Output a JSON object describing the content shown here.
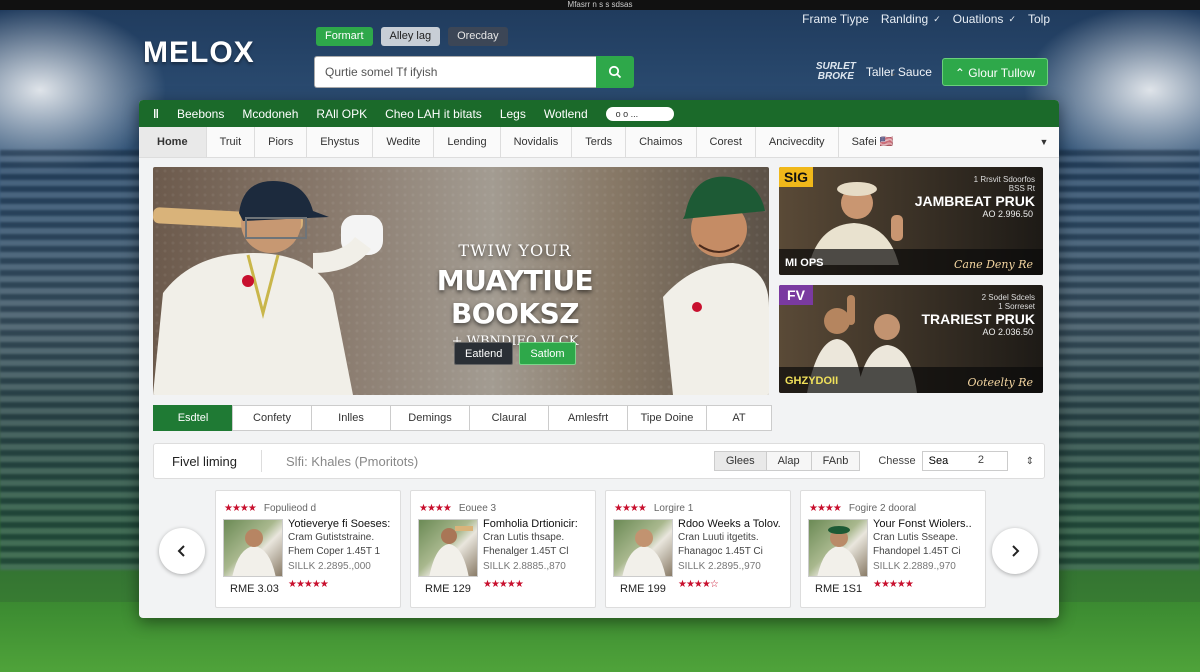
{
  "window": {
    "top_caption": "Mfasrr n s s sdsas"
  },
  "top_nav": [
    {
      "label": "Frame Tiype",
      "has_dropdown": false
    },
    {
      "label": "Ranlding",
      "has_dropdown": true
    },
    {
      "label": "Ouatilons",
      "has_dropdown": true
    },
    {
      "label": "Tolp",
      "has_dropdown": false
    }
  ],
  "logo": {
    "text": "MELOX"
  },
  "pill_tabs": [
    {
      "label": "Formart",
      "state": "active"
    },
    {
      "label": "Alley lag",
      "state": "normal"
    },
    {
      "label": "Orecday",
      "state": "dark"
    }
  ],
  "search": {
    "value": "Qurtie somel Tf ifyish",
    "button_icon": "search-icon"
  },
  "brand_right": {
    "mini_logo": "SURLET BROKE",
    "text": "Taller Sauce",
    "follow_label": "Glour Tullow"
  },
  "green_nav": {
    "items": [
      "Beebons",
      "Mcodoneh",
      "RAll OPK",
      "Cheo LAH it bitats",
      "Legs",
      "Wotlend"
    ],
    "toggle_label": "o o ..."
  },
  "sub_nav": {
    "items": [
      "Home",
      "Truit",
      "Piors",
      "Ehystus",
      "Wedite",
      "Lending",
      "Novidalis",
      "Terds",
      "Chaimos",
      "Corest",
      "Ancivecdity",
      "Safei 🇺🇸"
    ],
    "active_index": 0
  },
  "hero": {
    "kicker": "TWIW YOUR",
    "title": "MUAYTIUE BOOKSZ",
    "subtitle": "+ WBNDIEO VLCK",
    "buttons": [
      {
        "label": "Eatlend",
        "style": "dark"
      },
      {
        "label": "Satlom",
        "style": "green"
      }
    ]
  },
  "promos": [
    {
      "tag": "SIG",
      "tag_color": "#f0b81a",
      "small": "1 Rrsvit Sdoorfos\nBSS Rt",
      "title": "JAMBREAT PRUK",
      "sub": "AO 2.996.50",
      "foot_left": "MI OPS",
      "foot_right": "Cane Deny Re"
    },
    {
      "tag": "FV",
      "tag_color": "#7a3aa0",
      "small": "2 Sodel Sdcels\n1 Sorreset",
      "title": "TRARIEST PRUK",
      "sub": "AO 2.036.50",
      "foot_left": "GHZYDOII",
      "foot_right": "Ooteelty Re"
    }
  ],
  "categories": [
    {
      "label": "Esdtel",
      "active": true
    },
    {
      "label": "Confety",
      "active": false
    },
    {
      "label": "Inlles",
      "active": false
    },
    {
      "label": "Demings",
      "active": false
    },
    {
      "label": "Claural",
      "active": false
    },
    {
      "label": "Amlesfrt",
      "active": false
    },
    {
      "label": "Tipe Doine",
      "active": false
    },
    {
      "label": "AT",
      "active": false,
      "narrow": true
    }
  ],
  "filter_bar": {
    "title": "Fivel liming",
    "subtitle": "Slfi: Khales (Pmoritots)",
    "buttons": [
      "Glees",
      "Alap",
      "FAnb"
    ],
    "field_label": "Chesse",
    "field_value": "Sea",
    "field_number": "2",
    "sort_icon": "sort-icon"
  },
  "products": [
    {
      "rating_count": "Fopulieod d",
      "title": "Yotieverye fi Soeses:",
      "l2": "Cram Gutiststraine.",
      "l3": "Fhem Coper 1.45T 1",
      "l4": "SILLK 2.2895.,000",
      "price": "RME 3.03"
    },
    {
      "rating_count": "Eouee 3",
      "title": "Fomholia Drtionicir:",
      "l2": "Cran Lutis thsape.",
      "l3": "Fhenalger 1.45T Cl",
      "l4": "SILLK 2.8885.,870",
      "price": "RME 129"
    },
    {
      "rating_count": "Lorgire 1",
      "title": "Rdoo Weeks a Tolov.",
      "l2": "Cran Luuti itgetits.",
      "l3": "Fhanagoc 1.45T Ci",
      "l4": "SILLK 2.2895.,970",
      "price": "RME 199"
    },
    {
      "rating_count": "Fogire 2 dooral",
      "title": "Your Fonst Wiolers..",
      "l2": "Cran Lutis Sseape.",
      "l3": "Fhandopel 1.45T Ci",
      "l4": "SILLK 2.2889.,970",
      "price": "RME 1S1"
    }
  ],
  "colors": {
    "brand_green": "#2ea84a",
    "nav_green": "#1b6a2a",
    "star_red": "#c8102e"
  }
}
